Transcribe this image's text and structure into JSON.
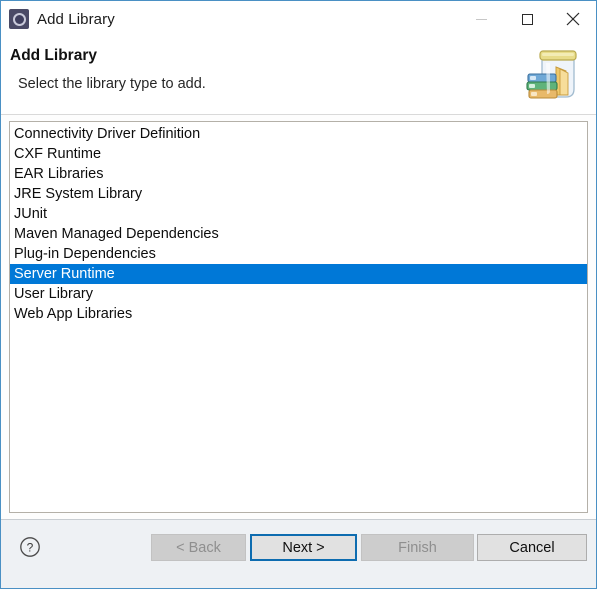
{
  "window": {
    "title": "Add Library",
    "title_icon": "library-gear-icon",
    "accent_color": "#4a90c4",
    "controls": {
      "minimize": "minimize-icon",
      "maximize": "maximize-icon",
      "close": "close-icon"
    }
  },
  "header": {
    "title": "Add Library",
    "subtitle": "Select the library type to add.",
    "banner_icon": "jar-with-books-icon"
  },
  "list": {
    "selected_index": 7,
    "selection_color": "#0078d7",
    "items": [
      {
        "label": "Connectivity Driver Definition"
      },
      {
        "label": "CXF Runtime"
      },
      {
        "label": "EAR Libraries"
      },
      {
        "label": "JRE System Library"
      },
      {
        "label": "JUnit"
      },
      {
        "label": "Maven Managed Dependencies"
      },
      {
        "label": "Plug-in Dependencies"
      },
      {
        "label": "Server Runtime"
      },
      {
        "label": "User Library"
      },
      {
        "label": "Web App Libraries"
      }
    ]
  },
  "footer": {
    "help_icon": "question-mark-icon",
    "buttons": {
      "back": {
        "label": "< Back",
        "state": "disabled"
      },
      "next": {
        "label": "Next >",
        "state": "focused"
      },
      "finish": {
        "label": "Finish",
        "state": "disabled"
      },
      "cancel": {
        "label": "Cancel",
        "state": "normal"
      }
    }
  }
}
